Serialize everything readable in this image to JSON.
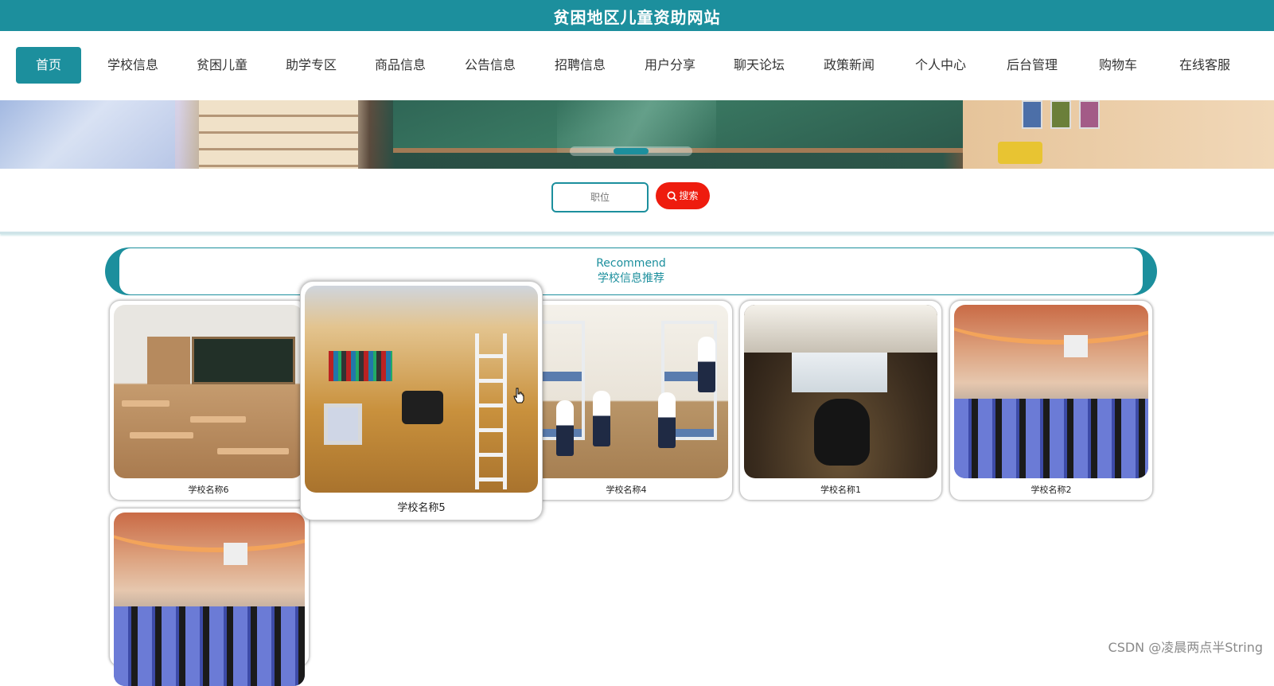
{
  "header": {
    "title": "贫困地区儿童资助网站"
  },
  "nav": {
    "items": [
      {
        "label": "首页",
        "active": true
      },
      {
        "label": "学校信息"
      },
      {
        "label": "贫困儿童"
      },
      {
        "label": "助学专区"
      },
      {
        "label": "商品信息"
      },
      {
        "label": "公告信息"
      },
      {
        "label": "招聘信息"
      },
      {
        "label": "用户分享"
      },
      {
        "label": "聊天论坛"
      },
      {
        "label": "政策新闻"
      },
      {
        "label": "个人中心"
      },
      {
        "label": "后台管理"
      },
      {
        "label": "购物车"
      },
      {
        "label": "在线客服"
      }
    ]
  },
  "search": {
    "placeholder": "职位",
    "button_label": "搜索",
    "button_icon": "search-icon"
  },
  "recommend": {
    "title_en": "Recommend",
    "title_cn": "学校信息推荐"
  },
  "schools": [
    {
      "name": "学校名称6",
      "image": "classroom"
    },
    {
      "name": "学校名称5",
      "image": "dorm-desk",
      "hovered": true
    },
    {
      "name": "学校名称4",
      "image": "dorm-bunks"
    },
    {
      "name": "学校名称1",
      "image": "meeting-room"
    },
    {
      "name": "学校名称2",
      "image": "lecture-hall"
    },
    {
      "name": "",
      "image": "lecture-hall"
    }
  ],
  "colors": {
    "primary": "#1c8f9d",
    "search_button": "#ee1c0e"
  },
  "watermark": "CSDN @凌晨两点半String"
}
